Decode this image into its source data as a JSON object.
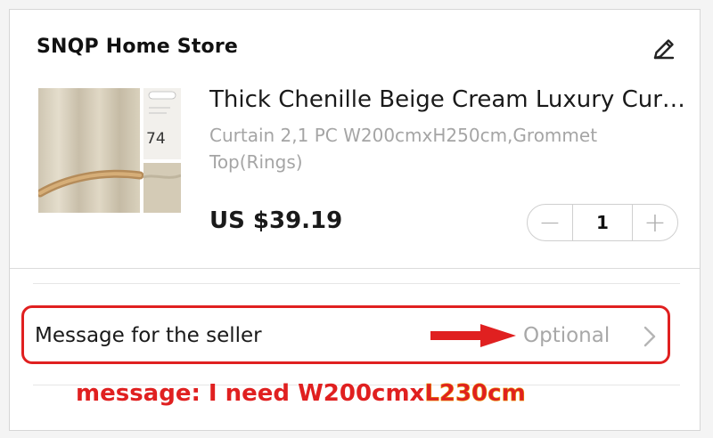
{
  "store": {
    "name": "SNQP Home Store",
    "edit_icon": "pencil-icon"
  },
  "product": {
    "title": "Thick Chenille Beige Cream Luxury Curtain",
    "variant": "Curtain 2,1 PC W200cmxH250cm,Grommet Top(Rings)",
    "price": "US $39.19",
    "image_badge": "74",
    "quantity": "1",
    "minus_label": "−",
    "plus_label": "+"
  },
  "message": {
    "label": "Message for the seller",
    "placeholder": "Optional",
    "chevron_icon": "chevron-right-icon"
  },
  "annotation": {
    "prefix": "message: I need W200cmx",
    "highlight": "L230cm",
    "arrow_icon": "arrow-right-icon"
  },
  "colors": {
    "annotation_red": "#e02020",
    "muted_text": "#a8a8a8"
  }
}
